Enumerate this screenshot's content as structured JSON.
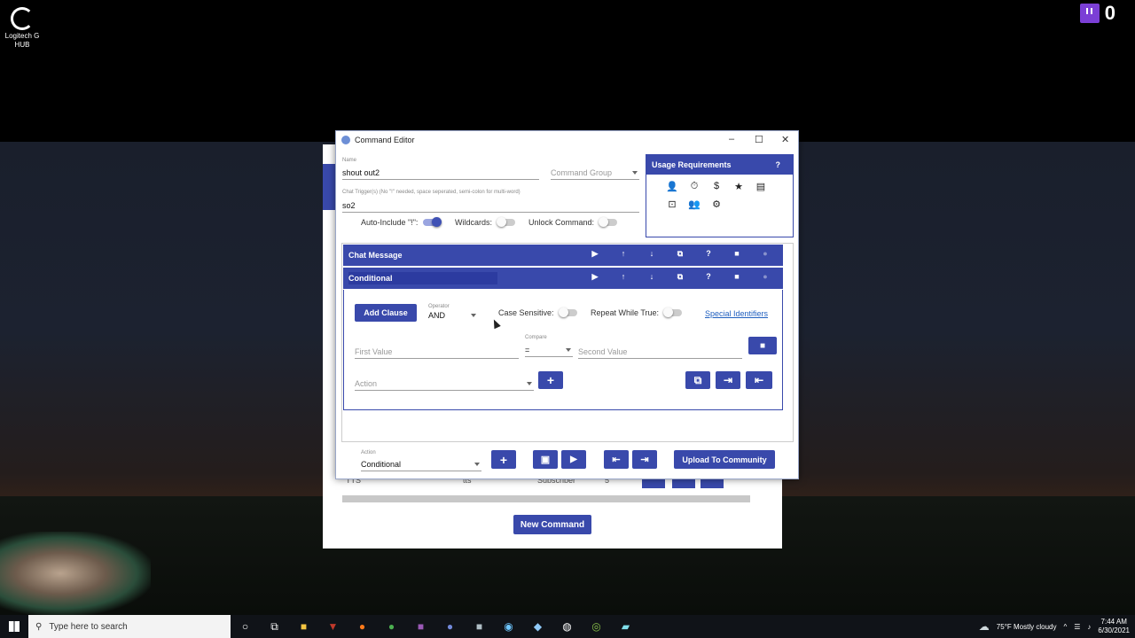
{
  "desktop": {
    "icon_label": "Logitech G HUB",
    "twitch_count": "0"
  },
  "background_window": {
    "row": {
      "col1": "TTS",
      "col2": "tts",
      "col3": "Subscriber",
      "col4": "5"
    },
    "new_command_label": "New Command"
  },
  "editor": {
    "title": "Command Editor",
    "name": {
      "label": "Name",
      "value": "shout out2"
    },
    "command_group": {
      "placeholder": "Command Group"
    },
    "triggers": {
      "label": "Chat Trigger(s) (No \"!\" needed, space seperated, semi-colon for multi-word)",
      "value": "so2"
    },
    "toggles": {
      "auto_include": "Auto-Include \"!\":",
      "wildcards": "Wildcards:",
      "unlock": "Unlock Command:"
    },
    "usage": {
      "title": "Usage Requirements",
      "help": "?",
      "icons": [
        "role-icon",
        "cooldown-icon",
        "currency-icon",
        "rank-icon",
        "inventory-icon",
        "threshold-icon",
        "users-icon",
        "settings-icon"
      ]
    },
    "actions": [
      {
        "label": "Chat Message"
      },
      {
        "label": "Conditional"
      }
    ],
    "action_buttons": [
      "play-icon",
      "move-up-icon",
      "move-down-icon",
      "copy-icon",
      "help-icon",
      "delete-icon"
    ],
    "conditional": {
      "add_clause": "Add Clause",
      "operator_label": "Operator",
      "operator_value": "AND",
      "case_sensitive": "Case Sensitive:",
      "repeat_while_true": "Repeat While True:",
      "special_identifiers": "Special Identifiers",
      "first_value": "First Value",
      "compare_label": "Compare",
      "compare_value": "=",
      "second_value": "Second Value",
      "action_placeholder": "Action"
    },
    "footer": {
      "action_label": "Action",
      "action_value": "Conditional",
      "upload": "Upload To Community"
    }
  },
  "taskbar": {
    "search_placeholder": "Type here to search",
    "weather": "75°F  Mostly cloudy",
    "time": "7:44 AM",
    "date": "6/30/2021"
  }
}
